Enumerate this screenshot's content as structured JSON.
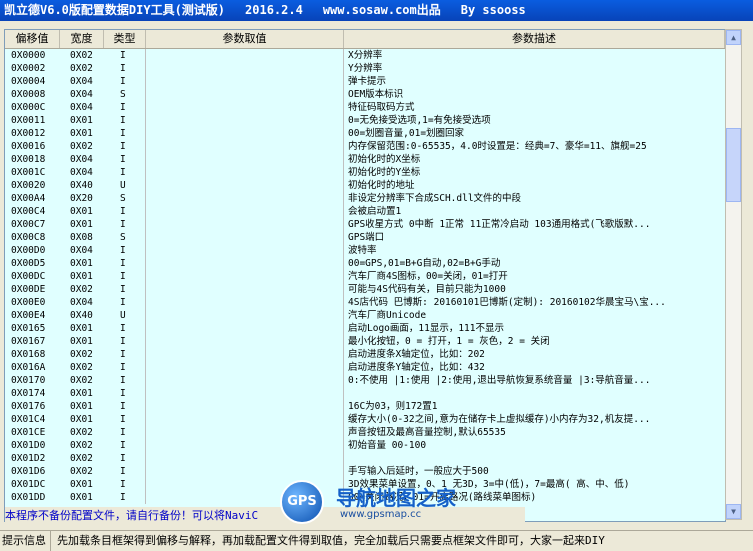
{
  "window": {
    "title": "凯立德V6.0版配置数据DIY工具(测试版)",
    "date": "2016.2.4",
    "site": "www.sosaw.com出品",
    "author": "By ssooss"
  },
  "list": {
    "columns": [
      "偏移值",
      "宽度",
      "类型",
      "参数取值",
      "参数描述"
    ],
    "rows": [
      [
        "0X0000",
        "0X02",
        "I",
        "",
        "X分辨率"
      ],
      [
        "0X0002",
        "0X02",
        "I",
        "",
        "Y分辨率"
      ],
      [
        "0X0004",
        "0X04",
        "I",
        "",
        "弹卡提示"
      ],
      [
        "0X0008",
        "0X04",
        "S",
        "",
        "OEM版本标识"
      ],
      [
        "0X000C",
        "0X04",
        "I",
        "",
        "特征码取码方式"
      ],
      [
        "0X0011",
        "0X01",
        "I",
        "",
        "0=无免接受选项,1=有免接受选项"
      ],
      [
        "0X0012",
        "0X01",
        "I",
        "",
        "00=划圈音量,01=划圈回家"
      ],
      [
        "0X0016",
        "0X02",
        "I",
        "",
        "内存保留范围:0-65535，4.0时设置是：经典=7、豪华=11、旗舰=25"
      ],
      [
        "0X0018",
        "0X04",
        "I",
        "",
        "初始化时的X坐标"
      ],
      [
        "0X001C",
        "0X04",
        "I",
        "",
        "初始化时的Y坐标"
      ],
      [
        "0X0020",
        "0X40",
        "U",
        "",
        "初始化时的地址"
      ],
      [
        "0X00A4",
        "0X20",
        "S",
        "",
        "非设定分辨率下合成SCH.dll文件的中段"
      ],
      [
        "0X00C4",
        "0X01",
        "I",
        "",
        "会被启动置1"
      ],
      [
        "0X00C7",
        "0X01",
        "I",
        "",
        "GPS收星方式 0中断 1正常 11正常冷启动 103通用格式(飞歌版默..."
      ],
      [
        "0X00C8",
        "0X08",
        "S",
        "",
        "GPS端口"
      ],
      [
        "0X00D0",
        "0X04",
        "I",
        "",
        "波特率"
      ],
      [
        "0X00D5",
        "0X01",
        "I",
        "",
        "00=GPS,01=B+G自动,02=B+G手动"
      ],
      [
        "0X00DC",
        "0X01",
        "I",
        "",
        "汽车厂商4S图标，00=关闭，01=打开"
      ],
      [
        "0X00DE",
        "0X02",
        "I",
        "",
        "可能与4S代码有关，目前只能为1000"
      ],
      [
        "0X00E0",
        "0X04",
        "I",
        "",
        "4S店代码 巴博斯: 20160101巴博斯(定制): 20160102华晨宝马\\宝..."
      ],
      [
        "0X00E4",
        "0X40",
        "U",
        "",
        "汽车厂商Unicode"
      ],
      [
        "0X0165",
        "0X01",
        "I",
        "",
        "启动Logo画面，11显示，111不显示"
      ],
      [
        "0X0167",
        "0X01",
        "I",
        "",
        "最小化按钮，0 = 打开，1 = 灰色，2 = 关闭"
      ],
      [
        "0X0168",
        "0X02",
        "I",
        "",
        "启动进度条X轴定位，比如：202"
      ],
      [
        "0X016A",
        "0X02",
        "I",
        "",
        "启动进度条Y轴定位，比如：432"
      ],
      [
        "0X0170",
        "0X02",
        "I",
        "",
        "0:不使用 |1:使用 |2:使用,退出导航恢复系统音量 |3:导航音量..."
      ],
      [
        "0X0174",
        "0X01",
        "I",
        "",
        ""
      ],
      [
        "0X0176",
        "0X01",
        "I",
        "",
        "16C为03，则172置1"
      ],
      [
        "0X01C4",
        "0X01",
        "I",
        "",
        "缓存大小(0-32之间,意为在储存卡上虚拟缓存)小内存为32,机友提..."
      ],
      [
        "0X01CE",
        "0X02",
        "I",
        "",
        "声音按钮及最高音量控制,默认65535"
      ],
      [
        "0X01D0",
        "0X02",
        "I",
        "",
        "初始音量 00-100"
      ],
      [
        "0X01D2",
        "0X02",
        "I",
        "",
        ""
      ],
      [
        "0X01D6",
        "0X02",
        "I",
        "",
        "手写输入后延时，一般应大于500"
      ],
      [
        "0X01DC",
        "0X01",
        "I",
        "",
        "3D效果菜单设置，0、1 无3D，3=中(低)，7=最高( 高、中、低)"
      ],
      [
        "0X01DD",
        "0X01",
        "I",
        "",
        "00=关闭路况，01=开启路况(路线菜单图标)"
      ]
    ]
  },
  "notice": "本程序不备份配置文件，请自行备份！可以将NaviC",
  "logo": {
    "badge": "GPS",
    "name": "导航地图之家",
    "url": "www.gpsmap.cc"
  },
  "status": {
    "label": "提示信息",
    "text": "先加载条目框架得到偏移与解释，再加载配置文件得到取值，完全加载后只需要点框架文件即可，大家一起来DIY"
  },
  "colors": {
    "title_bar": "#0843b8",
    "list_background": "#e0ffff",
    "notice_text": "#0000c8"
  }
}
